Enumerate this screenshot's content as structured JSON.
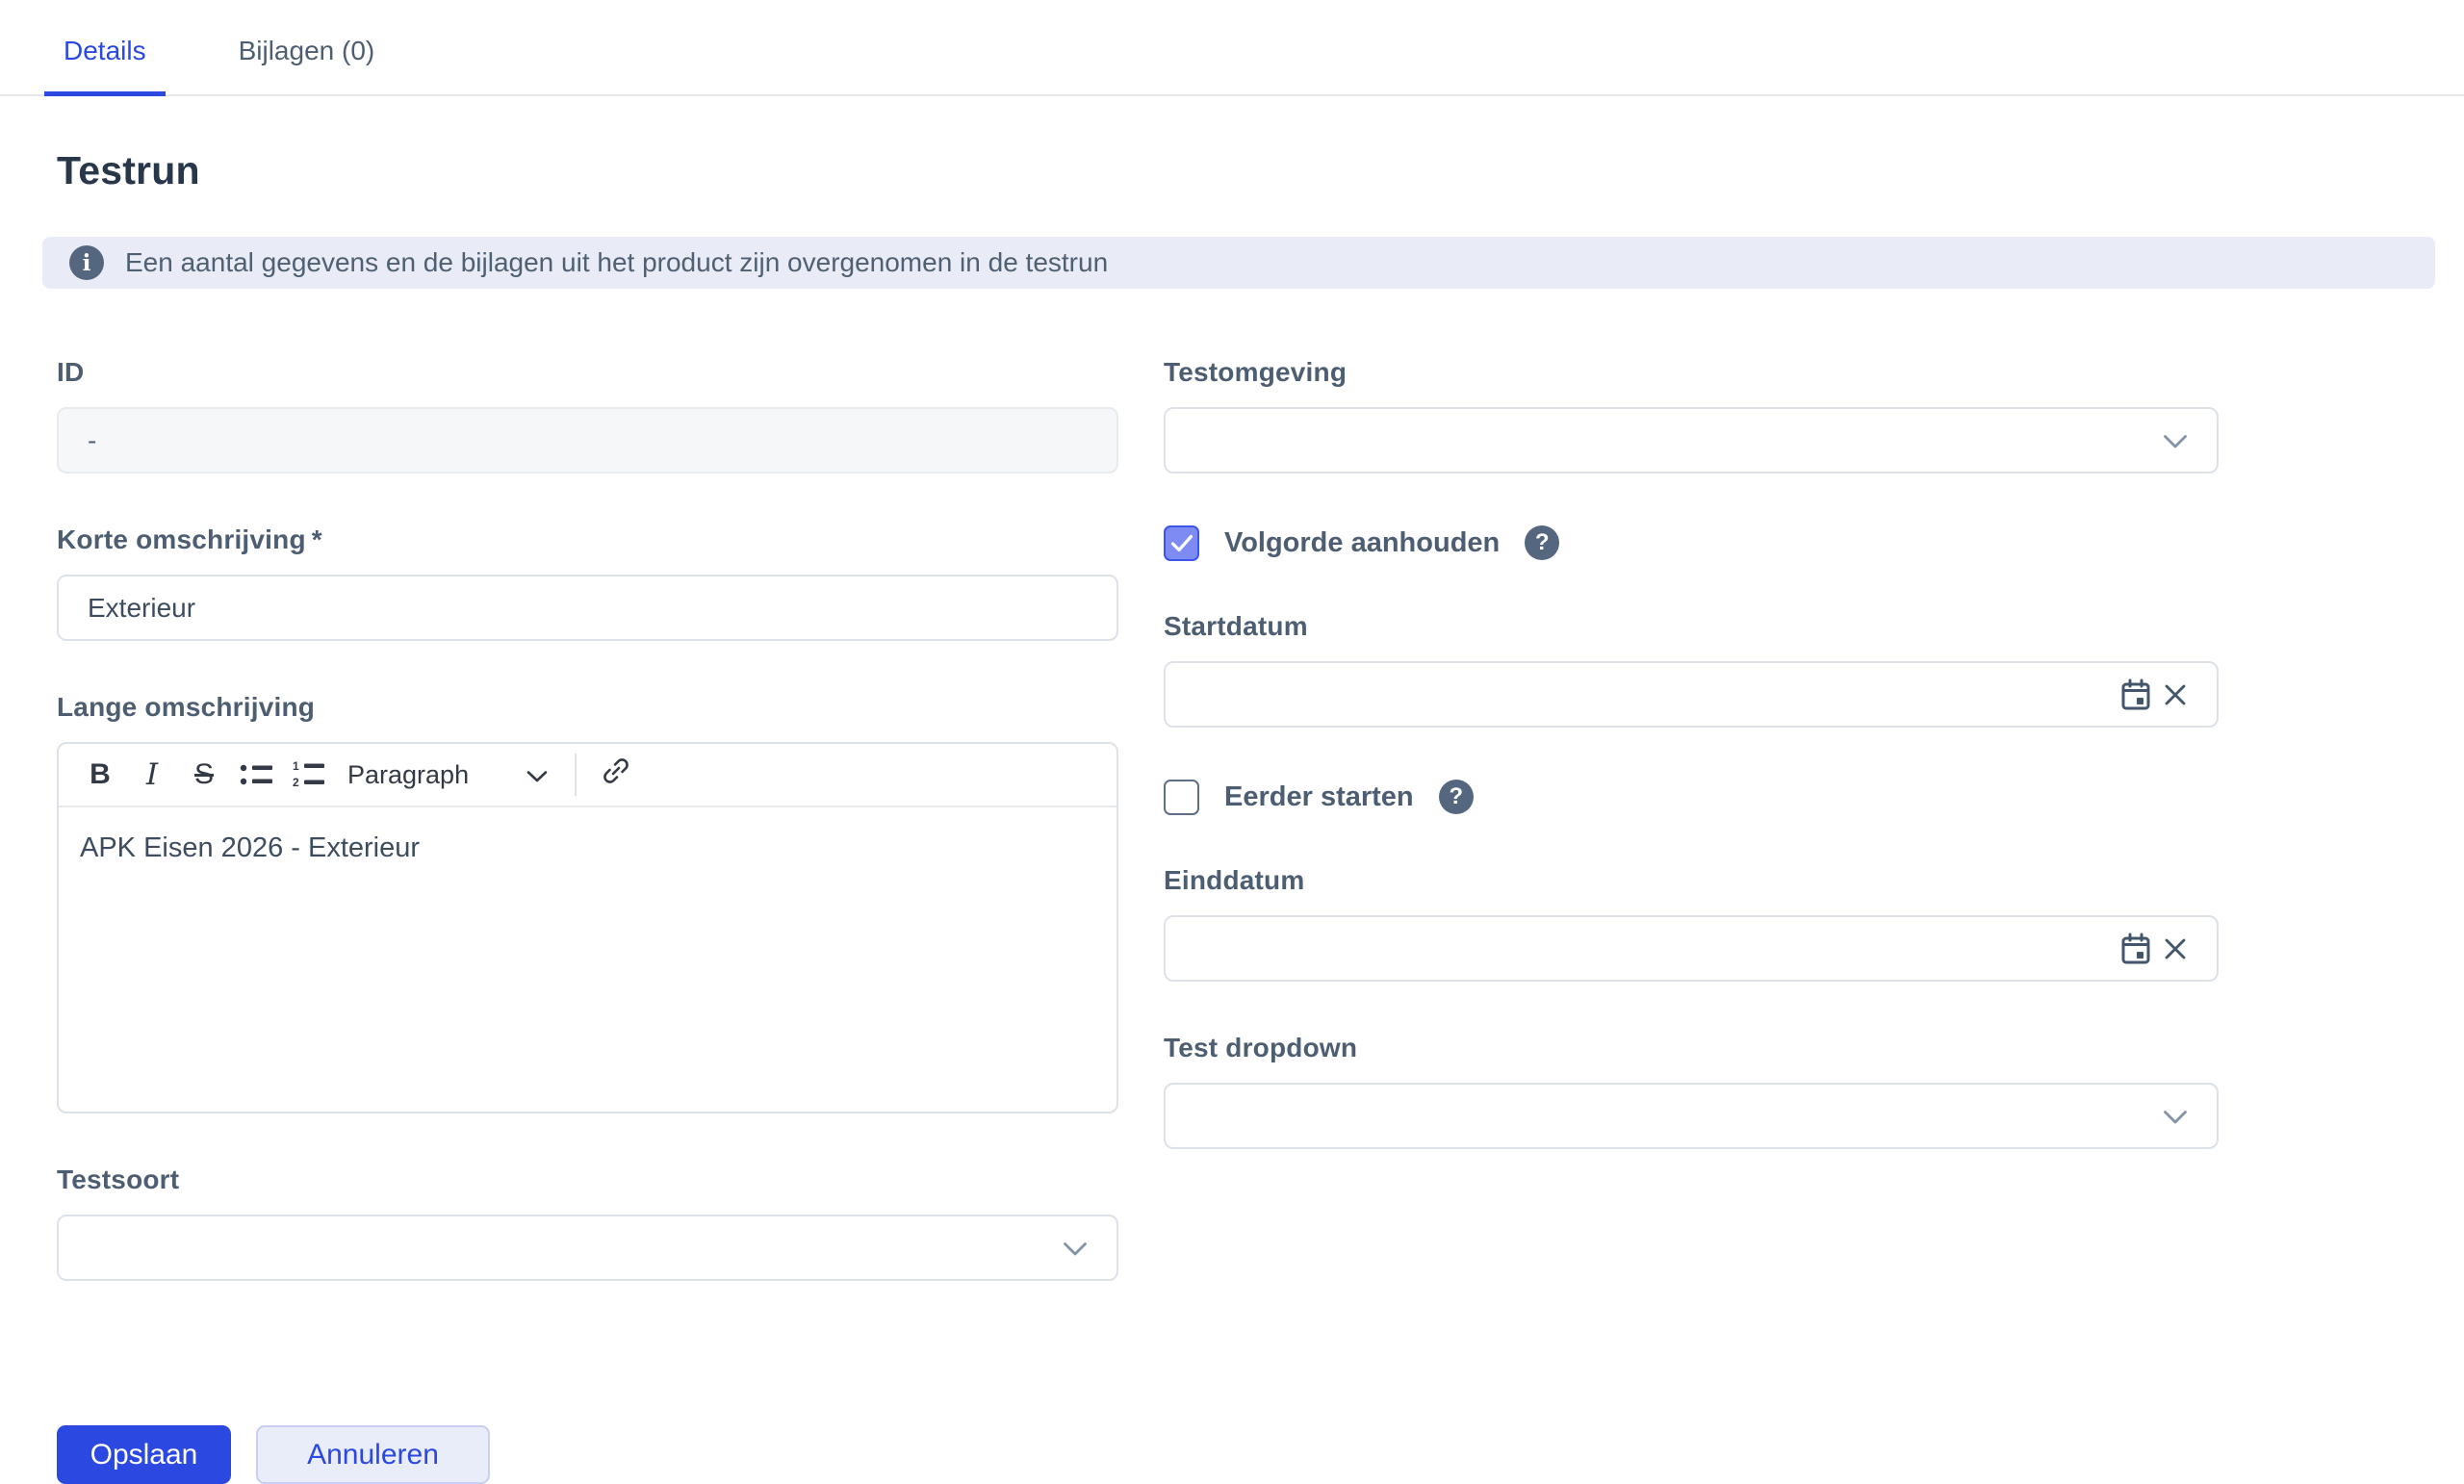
{
  "tabs": [
    {
      "label": "Details",
      "active": true
    },
    {
      "label": "Bijlagen (0)",
      "active": false
    }
  ],
  "page": {
    "title": "Testrun"
  },
  "banner": {
    "icon": "info-icon",
    "text": "Een aantal gegevens en de bijlagen uit het product zijn overgenomen in de testrun"
  },
  "form": {
    "id": {
      "label": "ID",
      "value": "-",
      "disabled": true
    },
    "korte_omschrijving": {
      "label": "Korte omschrijving",
      "required_mark": "*",
      "value": "Exterieur"
    },
    "lange_omschrijving": {
      "label": "Lange omschrijving",
      "content": "APK Eisen 2026 - Exterieur",
      "toolbar": {
        "bold": "B",
        "italic": "I",
        "strikethrough": "S",
        "bullet_list": "bullet-list-icon",
        "numbered_list": "numbered-list-icon",
        "paragraph_dropdown": "Paragraph",
        "link": "link-icon"
      }
    },
    "testsoort": {
      "label": "Testsoort",
      "value": ""
    },
    "testomgeving": {
      "label": "Testomgeving",
      "value": ""
    },
    "volgorde_aanhouden": {
      "label": "Volgorde aanhouden",
      "checked": true,
      "help_icon": "?"
    },
    "startdatum": {
      "label": "Startdatum",
      "value": ""
    },
    "eerder_starten": {
      "label": "Eerder starten",
      "checked": false,
      "help_icon": "?"
    },
    "einddatum": {
      "label": "Einddatum",
      "value": ""
    },
    "test_dropdown": {
      "label": "Test dropdown",
      "value": ""
    }
  },
  "actions": {
    "save_label": "Opslaan",
    "cancel_label": "Annuleren"
  },
  "icons": {
    "info": "i",
    "help": "?"
  },
  "colors": {
    "accent": "#2b48e0",
    "label_slate": "#4d5e72",
    "title": "#28374a",
    "banner_bg": "#e9ebf7",
    "checkbox_checked_fill": "#7e8bf3",
    "checkbox_checked_border": "#3c55ea",
    "disabled_input_bg": "#f6f7f9",
    "input_border": "#dde2e9"
  }
}
